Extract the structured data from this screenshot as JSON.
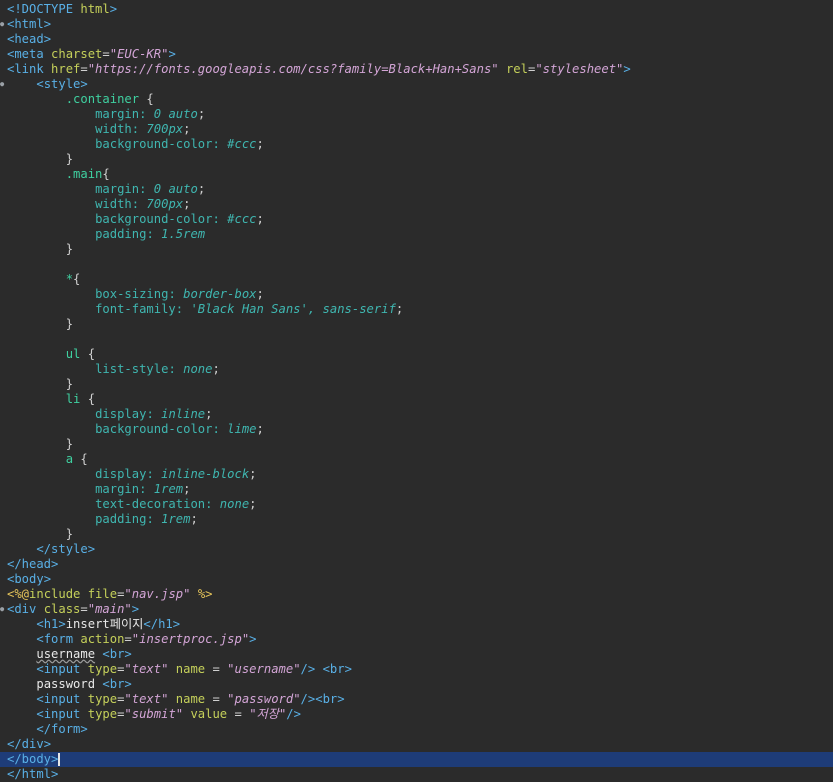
{
  "editor": {
    "language": "JSP / HTML",
    "colors": {
      "background": "#2b2b2b",
      "tag": "#59b0e6",
      "attribute": "#c5d05a",
      "string_value": "#d3a5d6",
      "css_property": "#3fb6b0",
      "text": "#e8e8e8",
      "selection_line": "#1e3c78"
    },
    "lines": [
      "<!DOCTYPE html>",
      "<html>",
      "<head>",
      "<meta charset=\"EUC-KR\">",
      "<link href=\"https://fonts.googleapis.com/css?family=Black+Han+Sans\" rel=\"stylesheet\">",
      "    <style>",
      "        .container {",
      "            margin: 0 auto;",
      "            width: 700px;",
      "            background-color: #ccc;",
      "        }",
      "        .main{",
      "            margin: 0 auto;",
      "            width: 700px;",
      "            background-color: #ccc;",
      "            padding: 1.5rem",
      "        }",
      "",
      "        *{",
      "            box-sizing: border-box;",
      "            font-family: 'Black Han Sans', sans-serif;",
      "        }",
      "",
      "        ul {",
      "            list-style: none;",
      "        }",
      "        li {",
      "            display: inline;",
      "            background-color: lime;",
      "        }",
      "        a {",
      "            display: inline-block;",
      "            margin: 1rem;",
      "            text-decoration: none;",
      "            padding: 1rem;",
      "        }",
      "    </style>",
      "</head>",
      "<body>",
      "<%@include file=\"nav.jsp\" %>",
      "<div class=\"main\">",
      "    <h1>insert페이지</h1>",
      "    <form action=\"insertproc.jsp\">",
      "    username <br>",
      "    <input type=\"text\" name = \"username\"/> <br>",
      "    password <br>",
      "    <input type=\"text\" name = \"password\"/><br>",
      "    <input type=\"submit\" value = \"저장\"/>",
      "    </form>",
      "</div>",
      "</body>",
      "</html>"
    ]
  }
}
